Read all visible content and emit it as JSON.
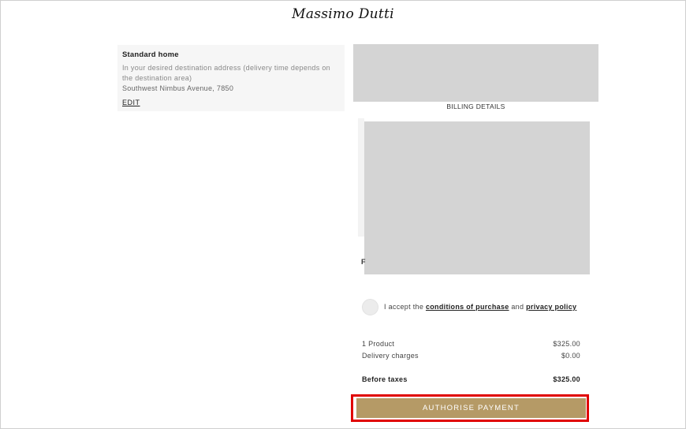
{
  "header": {
    "logo_text": "Massimo Dutti"
  },
  "shipping": {
    "title": "Standard home",
    "description": "In your desired destination address (delivery time depends on the destination area)",
    "address": "Southwest Nimbus Avenue, 7850",
    "edit_label": "EDIT"
  },
  "billing": {
    "title": "BILLING DETAILS",
    "stray_label": "F"
  },
  "terms": {
    "prefix": "I accept the",
    "conditions_link": "conditions of purchase",
    "joiner": "and",
    "privacy_link": "privacy policy"
  },
  "summary": {
    "products_label": "1 Product",
    "products_value": "$325.00",
    "delivery_label": "Delivery charges",
    "delivery_value": "$0.00",
    "before_taxes_label": "Before taxes",
    "before_taxes_value": "$325.00"
  },
  "actions": {
    "authorise_label": "AUTHORISE PAYMENT"
  },
  "colors": {
    "accent": "#b59a66",
    "highlight": "#e00000",
    "placeholder": "#d4d4d4"
  }
}
